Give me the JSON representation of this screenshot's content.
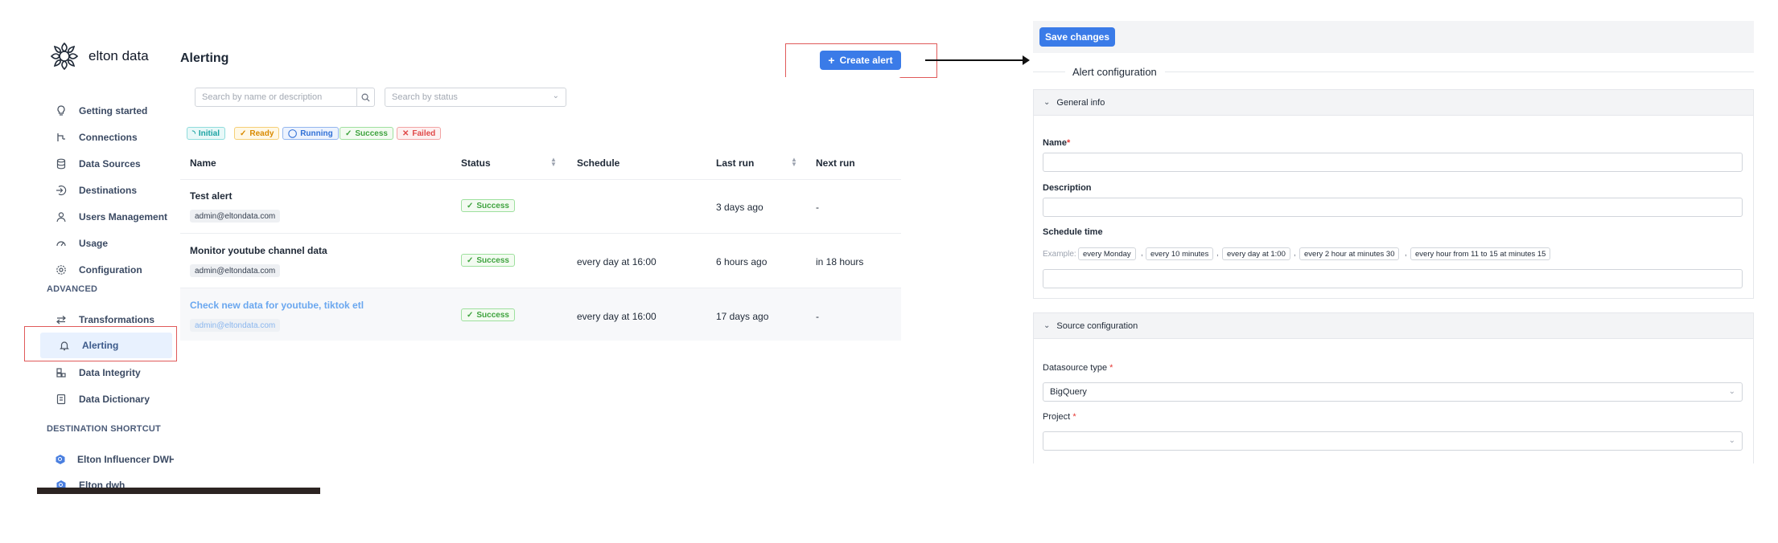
{
  "brand": {
    "name": "elton data"
  },
  "sidebar": {
    "items": [
      {
        "label": "Getting started",
        "icon": "lightbulb-icon"
      },
      {
        "label": "Connections",
        "icon": "connections-icon"
      },
      {
        "label": "Data Sources",
        "icon": "database-icon"
      },
      {
        "label": "Destinations",
        "icon": "destination-icon"
      },
      {
        "label": "Users Management",
        "icon": "user-icon"
      },
      {
        "label": "Usage",
        "icon": "gauge-icon"
      },
      {
        "label": "Configuration",
        "icon": "gear-icon"
      }
    ],
    "advanced_label": "ADVANCED",
    "advanced_items": [
      {
        "label": "Transformations",
        "icon": "swap-icon"
      },
      {
        "label": "Alerting",
        "icon": "bell-icon",
        "active": true
      },
      {
        "label": "Data Integrity",
        "icon": "integrity-icon"
      },
      {
        "label": "Data Dictionary",
        "icon": "book-icon"
      }
    ],
    "shortcut_label": "DESTINATION SHORTCUT",
    "shortcuts": [
      {
        "label": "Elton Influencer DWH",
        "icon": "bigquery-icon"
      },
      {
        "label": "Elton dwh",
        "icon": "bigquery-icon"
      }
    ]
  },
  "alerting": {
    "title": "Alerting",
    "create_button": "Create alert",
    "search_placeholder": "Search by name or description",
    "status_placeholder": "Search by status",
    "legend": [
      {
        "label": "Initial",
        "color": "#1ba3a3",
        "bg": "#e8f8f8",
        "border": "#8fdcdc"
      },
      {
        "label": "Ready",
        "color": "#d98a00",
        "bg": "#fff8e6",
        "border": "#f5cf76"
      },
      {
        "label": "Running",
        "color": "#2f6fd6",
        "bg": "#edf3fe",
        "border": "#93b6ee"
      },
      {
        "label": "Success",
        "color": "#3fa33f",
        "bg": "#f3fbf1",
        "border": "#9ee09e"
      },
      {
        "label": "Failed",
        "color": "#e04848",
        "bg": "#fdf0f0",
        "border": "#f2a4a4"
      }
    ],
    "columns": [
      "Name",
      "Status",
      "Schedule",
      "Last run",
      "Next run"
    ],
    "rows": [
      {
        "name": "Test alert",
        "owner": "admin@eltondata.com",
        "status": "Success",
        "schedule": "",
        "last_run": "3 days ago",
        "next_run": "-"
      },
      {
        "name": "Monitor youtube channel data",
        "owner": "admin@eltondata.com",
        "status": "Success",
        "schedule": "every day at 16:00",
        "last_run": "6 hours ago",
        "next_run": "in 18 hours"
      },
      {
        "name": "Check new data for youtube, tiktok etl",
        "owner": "admin@eltondata.com",
        "status": "Success",
        "schedule": "every day at 16:00",
        "last_run": "17 days ago",
        "next_run": "-"
      }
    ]
  },
  "form": {
    "save_button": "Save changes",
    "title": "Alert configuration",
    "general_section": "General info",
    "name_label": "Name",
    "name_value": "",
    "description_label": "Description",
    "description_value": "",
    "schedule_label": "Schedule time",
    "example_label": "Example:",
    "examples": [
      "every Monday",
      "every 10 minutes",
      "every day at 1:00",
      "every 2 hour at minutes 30",
      "every hour from 11 to 15 at minutes 15"
    ],
    "schedule_value": "",
    "source_section": "Source configuration",
    "datasource_label": "Datasource type",
    "datasource_value": "BigQuery",
    "project_label": "Project",
    "project_value": "",
    "required_mark": "*"
  },
  "colors": {
    "accent": "#3a7be8",
    "highlight": "#e05a5a"
  }
}
